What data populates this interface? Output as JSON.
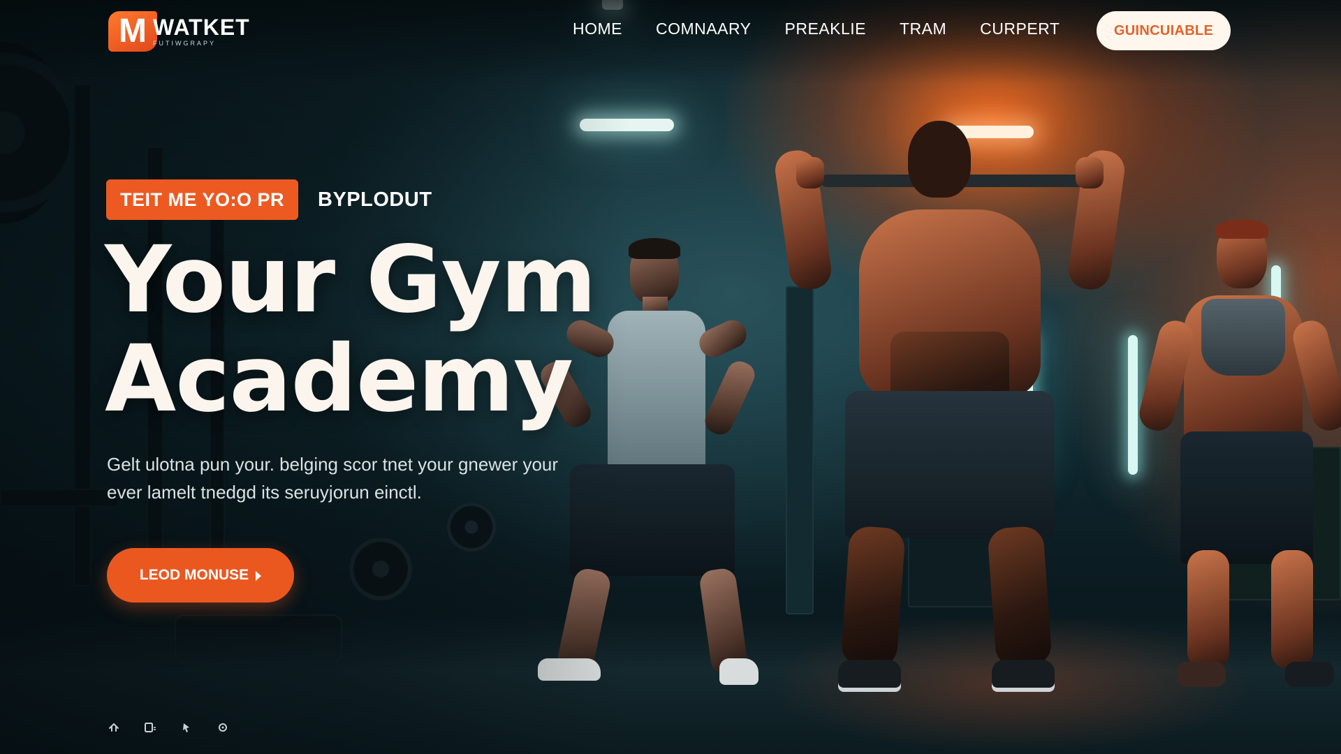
{
  "brand": {
    "logo_letter": "M",
    "name": "WATKET",
    "tagline": "FUTIWGRAPY",
    "accent_color": "#ea5820"
  },
  "nav": {
    "items": [
      {
        "label": "HOME"
      },
      {
        "label": "COMNAARY"
      },
      {
        "label": "PREAKLIE"
      },
      {
        "label": "TRAM"
      },
      {
        "label": "CURPERT"
      }
    ],
    "cta_label": "GUINCUIABLE"
  },
  "hero": {
    "badge": "TEIT ME YO:O PR",
    "badge_side": "BYPLODUT",
    "title_line1": "Your Gym",
    "title_line2": "Academy",
    "desc_line1": "Gelt ulotna pun your. belging scor tnet your gnewer your",
    "desc_line2": "ever lamelt tnedgd its seruyjorun einctl.",
    "button_label": "LEOD MONUSE"
  },
  "footer_icons": [
    {
      "icon": "home-icon"
    },
    {
      "icon": "calendar-icon"
    },
    {
      "icon": "pin-icon"
    },
    {
      "icon": "settings-icon"
    }
  ]
}
